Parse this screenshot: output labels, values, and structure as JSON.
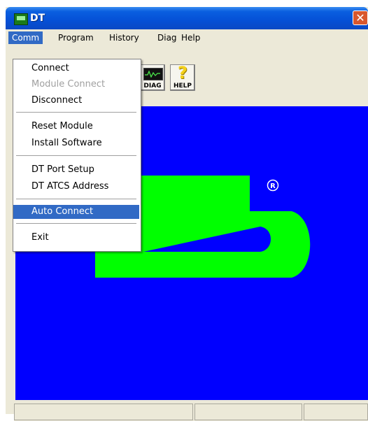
{
  "window": {
    "title": "DT",
    "close_glyph": "✕"
  },
  "menubar": {
    "items": [
      {
        "label": "Comm"
      },
      {
        "label": "Program"
      },
      {
        "label": "History"
      },
      {
        "label": "Diag"
      },
      {
        "label": "Help"
      }
    ]
  },
  "toolbar": {
    "diag_label": "DIAG",
    "help_label": "HELP",
    "help_glyph": "?"
  },
  "logo": {
    "registered_mark": "®"
  },
  "comm_menu": {
    "items": [
      {
        "label": "Connect"
      },
      {
        "label": "Module Connect"
      },
      {
        "label": "Disconnect"
      },
      {
        "label": "Reset Module"
      },
      {
        "label": "Install Software"
      },
      {
        "label": "DT Port Setup"
      },
      {
        "label": "DT ATCS Address"
      },
      {
        "label": "Auto Connect"
      },
      {
        "label": "Exit"
      }
    ]
  },
  "colors": {
    "canvas": "#0000ff",
    "logo": "#00ff00",
    "selection": "#316ac5"
  }
}
